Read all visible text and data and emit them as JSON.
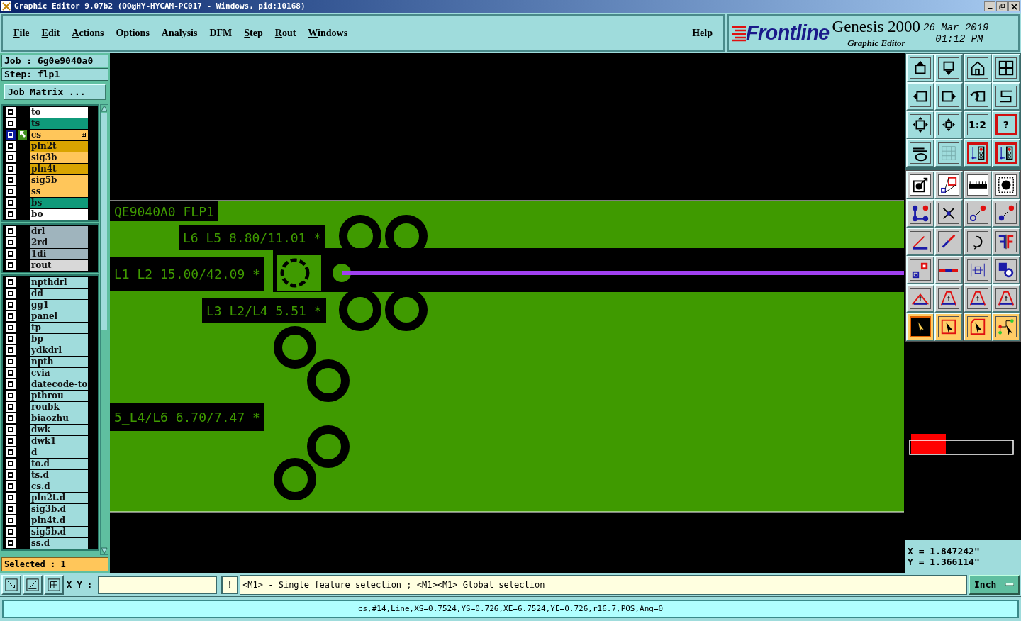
{
  "window": {
    "title": "Graphic Editor 9.07b2 (OO@HY-HYCAM-PC017 - Windows, pid:10168)"
  },
  "menu": [
    {
      "label": "File",
      "underlined": true
    },
    {
      "label": "Edit",
      "underlined": true
    },
    {
      "label": "Actions",
      "underlined": true
    },
    {
      "label": "Options",
      "underlined": false
    },
    {
      "label": "Analysis",
      "underlined": false
    },
    {
      "label": "DFM",
      "underlined": false
    },
    {
      "label": "Step",
      "underlined": true
    },
    {
      "label": "Rout",
      "underlined": true
    },
    {
      "label": "Windows",
      "underlined": true
    }
  ],
  "help": {
    "label": "Help",
    "underlined": false
  },
  "brand": {
    "logo": "Frontline",
    "product": "Genesis 2000",
    "subtitle": "Graphic Editor",
    "date": "26 Mar 2019",
    "time": "01:12 PM"
  },
  "job": {
    "job": "Job : 6g0e9040a0",
    "step": "Step: flp1",
    "matrix_button": "Job Matrix ..."
  },
  "layer_groups": [
    {
      "layers": [
        {
          "name": "to",
          "color": "#ffffff",
          "selected": false
        },
        {
          "name": "ts",
          "color": "#0f9a7a",
          "selected": false
        },
        {
          "name": "cs",
          "color": "#ffc65a",
          "selected": true
        },
        {
          "name": "pln2t",
          "color": "#d9a400",
          "selected": false
        },
        {
          "name": "sig3b",
          "color": "#ffc65a",
          "selected": false
        },
        {
          "name": "pln4t",
          "color": "#d9a400",
          "selected": false
        },
        {
          "name": "sig5b",
          "color": "#ffc65a",
          "selected": false
        },
        {
          "name": "ss",
          "color": "#ffc65a",
          "selected": false
        },
        {
          "name": "bs",
          "color": "#0f9a7a",
          "selected": false
        },
        {
          "name": "bo",
          "color": "#ffffff",
          "selected": false
        }
      ]
    },
    {
      "layers": [
        {
          "name": "drl",
          "color": "#9fb4bd",
          "selected": false
        },
        {
          "name": "2rd",
          "color": "#9fb4bd",
          "selected": false
        },
        {
          "name": "1di",
          "color": "#9fb4bd",
          "selected": false
        },
        {
          "name": "rout",
          "color": "#d8d8d8",
          "selected": false
        }
      ]
    },
    {
      "layers": [
        {
          "name": "npthdrl",
          "color": "#a0dcdc",
          "selected": false
        },
        {
          "name": "dd",
          "color": "#a0dcdc",
          "selected": false
        },
        {
          "name": "gg1",
          "color": "#a0dcdc",
          "selected": false
        },
        {
          "name": "panel",
          "color": "#a0dcdc",
          "selected": false
        },
        {
          "name": "tp",
          "color": "#a0dcdc",
          "selected": false
        },
        {
          "name": "bp",
          "color": "#a0dcdc",
          "selected": false
        },
        {
          "name": "ydkdrl",
          "color": "#a0dcdc",
          "selected": false
        },
        {
          "name": "npth",
          "color": "#a0dcdc",
          "selected": false
        },
        {
          "name": "cvia",
          "color": "#a0dcdc",
          "selected": false
        },
        {
          "name": "datecode-to",
          "color": "#a0dcdc",
          "selected": false
        },
        {
          "name": "pthrou",
          "color": "#a0dcdc",
          "selected": false
        },
        {
          "name": "roubk",
          "color": "#a0dcdc",
          "selected": false
        },
        {
          "name": "biaozhu",
          "color": "#a0dcdc",
          "selected": false
        },
        {
          "name": "dwk",
          "color": "#a0dcdc",
          "selected": false
        },
        {
          "name": "dwk1",
          "color": "#a0dcdc",
          "selected": false
        },
        {
          "name": "d",
          "color": "#a0dcdc",
          "selected": false
        },
        {
          "name": "to.d",
          "color": "#a0dcdc",
          "selected": false
        },
        {
          "name": "ts.d",
          "color": "#a0dcdc",
          "selected": false
        },
        {
          "name": "cs.d",
          "color": "#a0dcdc",
          "selected": false
        },
        {
          "name": "pln2t.d",
          "color": "#a0dcdc",
          "selected": false
        },
        {
          "name": "sig3b.d",
          "color": "#a0dcdc",
          "selected": false
        },
        {
          "name": "pln4t.d",
          "color": "#a0dcdc",
          "selected": false
        },
        {
          "name": "sig5b.d",
          "color": "#a0dcdc",
          "selected": false
        },
        {
          "name": "ss.d",
          "color": "#a0dcdc",
          "selected": false
        }
      ]
    }
  ],
  "selected_count": "Selected : 1",
  "canvas": {
    "labels": [
      {
        "text": "QE9040A0 FLP1"
      },
      {
        "text": "L6_L5 8.80/11.01 *"
      },
      {
        "text": "L1_L2 15.00/42.09 *"
      },
      {
        "text": "L3_L2/L4 5.51 *"
      },
      {
        "text": "5_L4/L6 6.70/7.47 *"
      }
    ]
  },
  "tools": [
    {
      "selected": false
    },
    {
      "selected": false
    },
    {
      "selected": false
    },
    {
      "selected": false
    },
    {
      "selected": false
    },
    {
      "selected": false
    },
    {
      "selected": false
    },
    {
      "selected": false
    },
    {
      "selected": false
    },
    {
      "selected": false
    },
    {
      "label": "1:2",
      "selected": false
    },
    {
      "label": "?",
      "selected": true
    },
    {
      "selected": false
    },
    {
      "selected": false
    },
    {
      "selected": true
    },
    {
      "selected": true
    },
    {
      "selected": false
    },
    {
      "selected": false
    },
    {
      "selected": false
    },
    {
      "selected": false
    },
    {
      "selected": false
    },
    {
      "selected": false
    },
    {
      "selected": false
    },
    {
      "selected": false
    },
    {
      "selected": false
    },
    {
      "selected": false
    },
    {
      "selected": false
    },
    {
      "selected": false
    },
    {
      "selected": false
    },
    {
      "selected": false
    },
    {
      "selected": false
    },
    {
      "selected": false
    },
    {
      "selected": false
    },
    {
      "selected": false
    },
    {
      "selected": false
    },
    {
      "selected": false
    },
    {
      "selected": true
    },
    {
      "selected": false
    },
    {
      "selected": false
    },
    {
      "selected": false
    }
  ],
  "coordinates": {
    "x": "X = 1.847242\"",
    "y": "Y = 1.366114\""
  },
  "bottom": {
    "xy_label": "X Y :",
    "alert": "!",
    "hint": "<M1> - Single feature selection ; <M1><M1> Global selection",
    "units": "Inch"
  },
  "status": "cs,#14,Line,XS=0.7524,YS=0.726,XE=6.7524,YE=0.726,r16.7,POS,Ang=0"
}
